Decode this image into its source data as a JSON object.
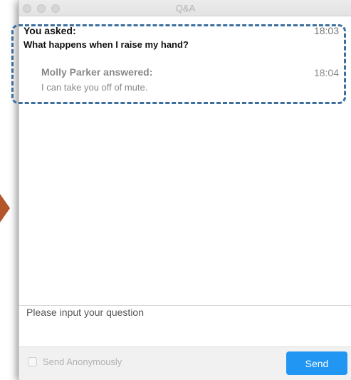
{
  "window": {
    "title": "Q&A"
  },
  "qa": {
    "question": {
      "label": "You asked:",
      "time": "18:03",
      "text": "What happens when I raise my hand?"
    },
    "answer": {
      "label": "Molly Parker answered:",
      "time": "18:04",
      "text": "I can take you off of mute."
    }
  },
  "composer": {
    "placeholder": "Please input your question",
    "value": ""
  },
  "footer": {
    "anonymous_label": "Send Anonymously",
    "anonymous_checked": false,
    "send_label": "Send"
  },
  "colors": {
    "send_button": "#2196f3",
    "highlight_border": "#3c6e9e",
    "pointer_arrow": "#b5562a"
  },
  "icons": {
    "pointer": "arrow-right-icon"
  }
}
